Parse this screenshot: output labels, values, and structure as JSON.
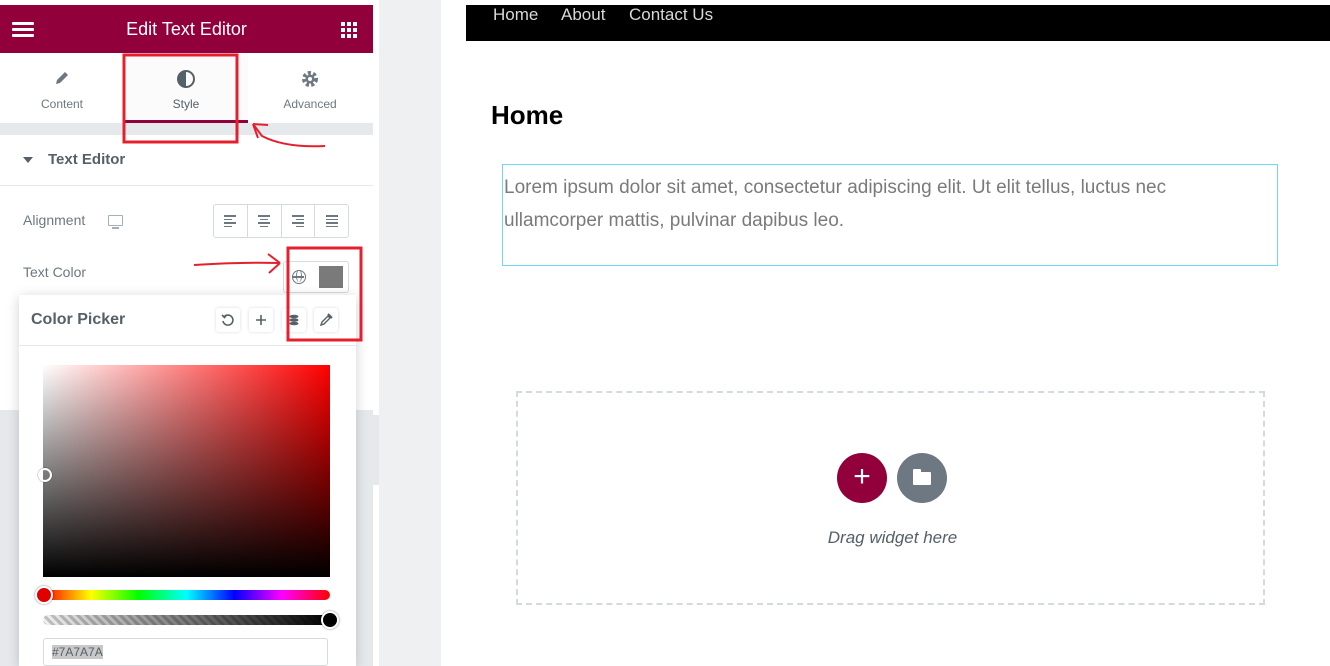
{
  "panel": {
    "header": {
      "title": "Edit Text Editor",
      "menu_icon": "hamburger-icon",
      "apps_icon": "grid-icon"
    },
    "tabs": [
      {
        "label": "Content",
        "icon": "pencil-icon",
        "active": false
      },
      {
        "label": "Style",
        "icon": "contrast-icon",
        "active": true
      },
      {
        "label": "Advanced",
        "icon": "gear-icon",
        "active": false
      }
    ],
    "section": {
      "title": "Text Editor",
      "expanded": true
    },
    "alignment": {
      "label": "Alignment",
      "device_icon": "monitor-icon",
      "options": [
        "left",
        "center",
        "right",
        "justify"
      ]
    },
    "text_color": {
      "label": "Text Color",
      "global_icon": "globe-icon",
      "value": "#7A7A7A"
    }
  },
  "color_picker": {
    "title": "Color Picker",
    "actions": [
      {
        "name": "reset",
        "icon": "reset-icon"
      },
      {
        "name": "add",
        "icon": "plus-icon"
      },
      {
        "name": "globals",
        "icon": "stack-icon"
      },
      {
        "name": "eyedropper",
        "icon": "eyedropper-icon"
      }
    ],
    "hex": "#7A7A7A",
    "hue_color": "#FF0000"
  },
  "preview": {
    "nav": [
      "Home",
      "About",
      "Contact Us"
    ],
    "heading": "Home",
    "paragraph": "Lorem ipsum dolor sit amet, consectetur adipiscing elit. Ut elit tellus, luctus nec ullamcorper mattis, pulvinar dapibus leo.",
    "drop_zone": {
      "add_label": "+",
      "hint": "Drag widget here"
    }
  },
  "colors": {
    "brand": "#92003b",
    "annotation": "#e5202e",
    "selected_border": "#71d7f7",
    "nav_bg": "#000000"
  }
}
